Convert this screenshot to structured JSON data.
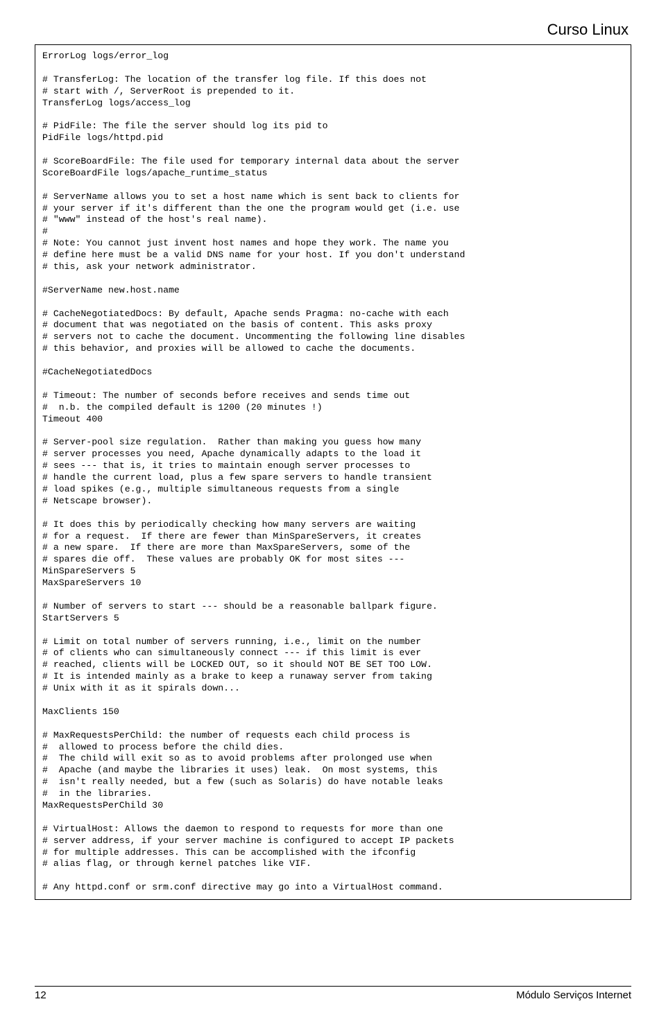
{
  "header": {
    "title": "Curso Linux"
  },
  "code": {
    "lines": [
      "ErrorLog logs/error_log",
      "",
      "# TransferLog: The location of the transfer log file. If this does not",
      "# start with /, ServerRoot is prepended to it.",
      "TransferLog logs/access_log",
      "",
      "# PidFile: The file the server should log its pid to",
      "PidFile logs/httpd.pid",
      "",
      "# ScoreBoardFile: The file used for temporary internal data about the server",
      "ScoreBoardFile logs/apache_runtime_status",
      "",
      "# ServerName allows you to set a host name which is sent back to clients for",
      "# your server if it's different than the one the program would get (i.e. use",
      "# \"www\" instead of the host's real name).",
      "#",
      "# Note: You cannot just invent host names and hope they work. The name you",
      "# define here must be a valid DNS name for your host. If you don't understand",
      "# this, ask your network administrator.",
      "",
      "#ServerName new.host.name",
      "",
      "# CacheNegotiatedDocs: By default, Apache sends Pragma: no-cache with each",
      "# document that was negotiated on the basis of content. This asks proxy",
      "# servers not to cache the document. Uncommenting the following line disables",
      "# this behavior, and proxies will be allowed to cache the documents.",
      "",
      "#CacheNegotiatedDocs",
      "",
      "# Timeout: The number of seconds before receives and sends time out",
      "#  n.b. the compiled default is 1200 (20 minutes !)",
      "Timeout 400",
      "",
      "# Server-pool size regulation.  Rather than making you guess how many",
      "# server processes you need, Apache dynamically adapts to the load it",
      "# sees --- that is, it tries to maintain enough server processes to",
      "# handle the current load, plus a few spare servers to handle transient",
      "# load spikes (e.g., multiple simultaneous requests from a single",
      "# Netscape browser).",
      "",
      "# It does this by periodically checking how many servers are waiting",
      "# for a request.  If there are fewer than MinSpareServers, it creates",
      "# a new spare.  If there are more than MaxSpareServers, some of the",
      "# spares die off.  These values are probably OK for most sites ---",
      "MinSpareServers 5",
      "MaxSpareServers 10",
      "",
      "# Number of servers to start --- should be a reasonable ballpark figure.",
      "StartServers 5",
      "",
      "# Limit on total number of servers running, i.e., limit on the number",
      "# of clients who can simultaneously connect --- if this limit is ever",
      "# reached, clients will be LOCKED OUT, so it should NOT BE SET TOO LOW.",
      "# It is intended mainly as a brake to keep a runaway server from taking",
      "# Unix with it as it spirals down...",
      "",
      "MaxClients 150",
      "",
      "# MaxRequestsPerChild: the number of requests each child process is",
      "#  allowed to process before the child dies.",
      "#  The child will exit so as to avoid problems after prolonged use when",
      "#  Apache (and maybe the libraries it uses) leak.  On most systems, this",
      "#  isn't really needed, but a few (such as Solaris) do have notable leaks",
      "#  in the libraries.",
      "MaxRequestsPerChild 30",
      "",
      "# VirtualHost: Allows the daemon to respond to requests for more than one",
      "# server address, if your server machine is configured to accept IP packets",
      "# for multiple addresses. This can be accomplished with the ifconfig",
      "# alias flag, or through kernel patches like VIF.",
      "",
      "# Any httpd.conf or srm.conf directive may go into a VirtualHost command."
    ]
  },
  "footer": {
    "page_number": "12",
    "module_label": "Módulo Serviços Internet"
  }
}
